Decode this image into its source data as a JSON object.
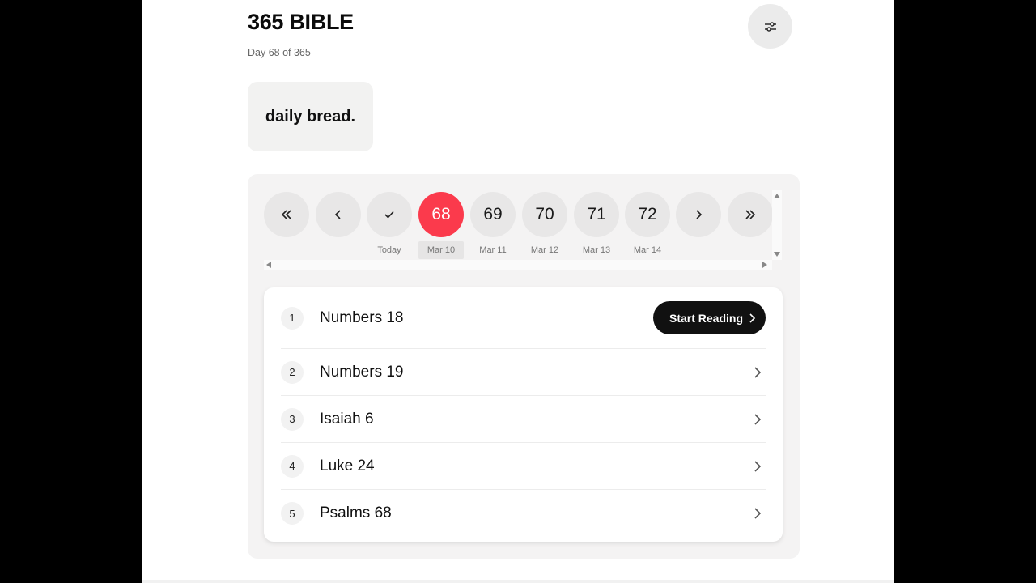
{
  "header": {
    "title": "365 BIBLE",
    "subtitle": "Day 68 of 365",
    "settings_icon": "sliders-icon"
  },
  "brand": {
    "text": "daily bread."
  },
  "day_nav": {
    "first_icon": "double-chevron-left-icon",
    "prev_icon": "chevron-left-icon",
    "today_icon": "check-icon",
    "today_label": "Today",
    "next_icon": "chevron-right-icon",
    "last_icon": "double-chevron-right-icon",
    "days": [
      {
        "number": "68",
        "date": "Mar 10",
        "active": true
      },
      {
        "number": "69",
        "date": "Mar 11",
        "active": false
      },
      {
        "number": "70",
        "date": "Mar 12",
        "active": false
      },
      {
        "number": "71",
        "date": "Mar 13",
        "active": false
      },
      {
        "number": "72",
        "date": "Mar 14",
        "active": false
      }
    ],
    "active_color": "#fb3a4c"
  },
  "readings": {
    "start_label": "Start Reading",
    "items": [
      {
        "index": "1",
        "title": "Numbers 18"
      },
      {
        "index": "2",
        "title": "Numbers 19"
      },
      {
        "index": "3",
        "title": "Isaiah 6"
      },
      {
        "index": "4",
        "title": "Luke 24"
      },
      {
        "index": "5",
        "title": "Psalms 68"
      }
    ]
  }
}
